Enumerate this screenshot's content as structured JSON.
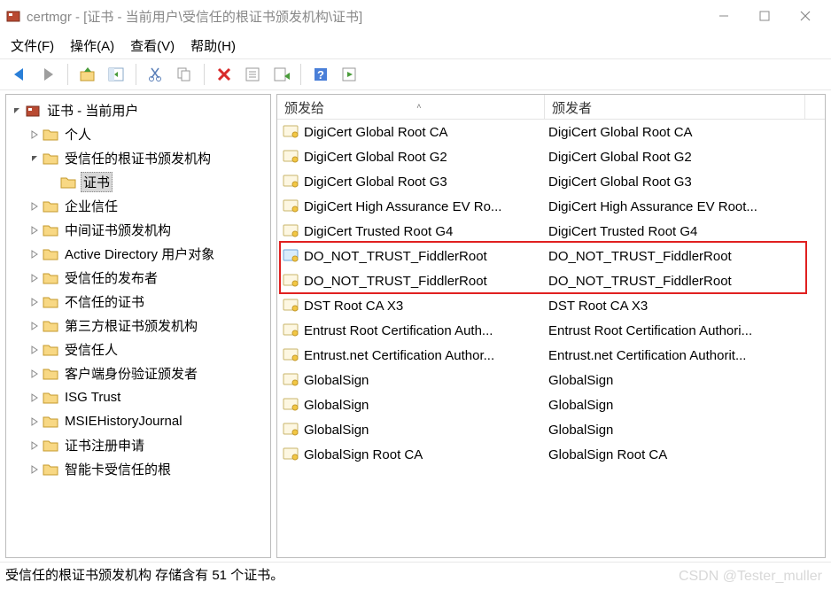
{
  "window": {
    "title": "certmgr - [证书 - 当前用户\\受信任的根证书颁发机构\\证书]"
  },
  "menubar": {
    "file": "文件(F)",
    "action": "操作(A)",
    "view": "查看(V)",
    "help": "帮助(H)"
  },
  "tree": {
    "root": "证书 - 当前用户",
    "nodes": [
      "个人",
      "受信任的根证书颁发机构",
      "企业信任",
      "中间证书颁发机构",
      "Active Directory 用户对象",
      "受信任的发布者",
      "不信任的证书",
      "第三方根证书颁发机构",
      "受信任人",
      "客户端身份验证颁发者",
      "ISG Trust",
      "MSIEHistoryJournal",
      "证书注册申请",
      "智能卡受信任的根"
    ],
    "selected_child": "证书"
  },
  "list": {
    "columns": {
      "c1": "颁发给",
      "c2": "颁发者"
    },
    "rows": [
      {
        "ico": "cert",
        "c1": "DigiCert Global Root CA",
        "c2": "DigiCert Global Root CA"
      },
      {
        "ico": "cert",
        "c1": "DigiCert Global Root G2",
        "c2": "DigiCert Global Root G2"
      },
      {
        "ico": "cert",
        "c1": "DigiCert Global Root G3",
        "c2": "DigiCert Global Root G3"
      },
      {
        "ico": "cert",
        "c1": "DigiCert High Assurance EV Ro...",
        "c2": "DigiCert High Assurance EV Root..."
      },
      {
        "ico": "cert",
        "c1": "DigiCert Trusted Root G4",
        "c2": "DigiCert Trusted Root G4"
      },
      {
        "ico": "alt",
        "c1": "DO_NOT_TRUST_FiddlerRoot",
        "c2": "DO_NOT_TRUST_FiddlerRoot"
      },
      {
        "ico": "cert",
        "c1": "DO_NOT_TRUST_FiddlerRoot",
        "c2": "DO_NOT_TRUST_FiddlerRoot"
      },
      {
        "ico": "cert",
        "c1": "DST Root CA X3",
        "c2": "DST Root CA X3"
      },
      {
        "ico": "cert",
        "c1": "Entrust Root Certification Auth...",
        "c2": "Entrust Root Certification Authori..."
      },
      {
        "ico": "cert",
        "c1": "Entrust.net Certification Author...",
        "c2": "Entrust.net Certification Authorit..."
      },
      {
        "ico": "cert",
        "c1": "GlobalSign",
        "c2": "GlobalSign"
      },
      {
        "ico": "cert",
        "c1": "GlobalSign",
        "c2": "GlobalSign"
      },
      {
        "ico": "cert",
        "c1": "GlobalSign",
        "c2": "GlobalSign"
      },
      {
        "ico": "cert",
        "c1": "GlobalSign Root CA",
        "c2": "GlobalSign Root CA"
      }
    ]
  },
  "statusbar": {
    "text": "受信任的根证书颁发机构 存储含有 51 个证书。"
  },
  "watermark": "CSDN @Tester_muller"
}
